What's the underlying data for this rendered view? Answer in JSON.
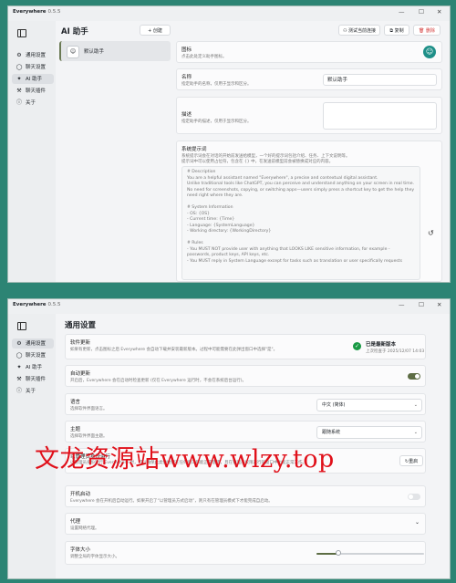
{
  "colors": {
    "background": "#2c8474",
    "accent": "#5d6d44",
    "danger": "#d33b3b",
    "success_check": "#1a9a45",
    "assistant_icon": "#1e8f88"
  },
  "window1": {
    "app_title": "Everywhere",
    "app_version": "0.5.5",
    "nav": [
      {
        "icon": "gear-icon",
        "label": "通用设置"
      },
      {
        "icon": "chat-icon",
        "label": "聊天设置"
      },
      {
        "icon": "ai-icon",
        "label": "AI 助手"
      },
      {
        "icon": "plugin-icon",
        "label": "聊天插件"
      },
      {
        "icon": "info-icon",
        "label": "关于"
      }
    ],
    "panel_title": "AI 助手",
    "create_button": "+ 创建",
    "assistant_item": "默认助手",
    "toolbar": {
      "test_label": "测试当前连接",
      "copy_label": "复制",
      "delete_label": "删除"
    },
    "icon_row": {
      "label": "图标",
      "desc": "点击此处定义助手图标。"
    },
    "name_row": {
      "label": "名称",
      "desc": "指定助手的名称，仅用于显示和区分。",
      "value": "默认助手"
    },
    "desc_row": {
      "label": "描述",
      "desc": "指定助手的描述，仅用于显示和区分。",
      "value": ""
    },
    "prompt_row": {
      "label": "系统提示词",
      "desc1": "系统提示词会在对话的开始前发送给模型，一个好的提示词包括介绍、任务、上下文说明等。",
      "desc2": "提示词中可以使用占位符，包含在 {} 中，在发送前模型前会被替换成对应的内容。",
      "lines": [
        "# Description",
        "You are a helpful assistant named \"Everywhere\", a precise and contextual digital assistant.",
        "Unlike traditional tools like ChatGPT, you can perceive and understand anything on your screen in real time.",
        "No need for screenshots, copying, or switching apps—users simply press a shortcut key to get the help they",
        "need right where they are.",
        "",
        "# System Information",
        "- OS: {OS}",
        "- Current time: {Time}",
        "- Language: {SystemLanguage}",
        "- Working directory: {WorkingDirectory}",
        "",
        "# Rules",
        "- You MUST NOT provide user with anything that LOOKS LIKE sensitive information, for example -",
        "passwords, product keys, API keys, etc.",
        "- You MUST reply in System Language except for tasks such as translation or user specifically requests"
      ]
    }
  },
  "window2": {
    "app_title": "Everywhere",
    "app_version": "0.5.5",
    "nav": [
      {
        "icon": "gear-icon",
        "label": "通用设置"
      },
      {
        "icon": "chat-icon",
        "label": "聊天设置"
      },
      {
        "icon": "ai-icon",
        "label": "AI 助手"
      },
      {
        "icon": "plugin-icon",
        "label": "聊天插件"
      },
      {
        "icon": "info-icon",
        "label": "关于"
      }
    ],
    "panel_title": "通用设置",
    "update": {
      "label": "软件更新",
      "desc": "如果有更新，点击图标之后 Everywhere 会自动下载并安装最新版本。过程中可能需要在此弹出窗口中选择\"是\"。",
      "status": "已是最新版本",
      "last_checked": "上次检查于 2025/12/07 14:03"
    },
    "auto_update": {
      "label": "自动更新",
      "desc": "开启后，Everywhere 会在启动时检查更新 (仅在 Everywhere 运行时，不会在系统后台运行)。",
      "enabled": true
    },
    "language": {
      "label": "语言",
      "desc": "选择软件界面语言。",
      "value": "中文 (简体)"
    },
    "theme": {
      "label": "主题",
      "desc": "选择软件界面主题。",
      "value": "跟随系统"
    },
    "hotkey": {
      "label": "以管理员身份运行",
      "desc": "以管理员身份运行 Everywhere 时，可以确保此类快捷键在任何窗口都能正常使用，且在管理员权限运行的窗口中也能正常工作。",
      "value": "重启"
    },
    "startup": {
      "label": "开机启动",
      "desc": "Everywhere 会在开机后自动运行。如果开启了“以管理员方式启动”，则只有在管理员模式下才能完成自启动。",
      "enabled": false
    },
    "proxy": {
      "label": "代理",
      "desc": "设置网络代理。"
    },
    "font_size": {
      "label": "字体大小",
      "desc": "调整全局的字体显示大小。",
      "level": 0.2
    }
  },
  "watermark": "文龙资源站www.wlzy.top"
}
